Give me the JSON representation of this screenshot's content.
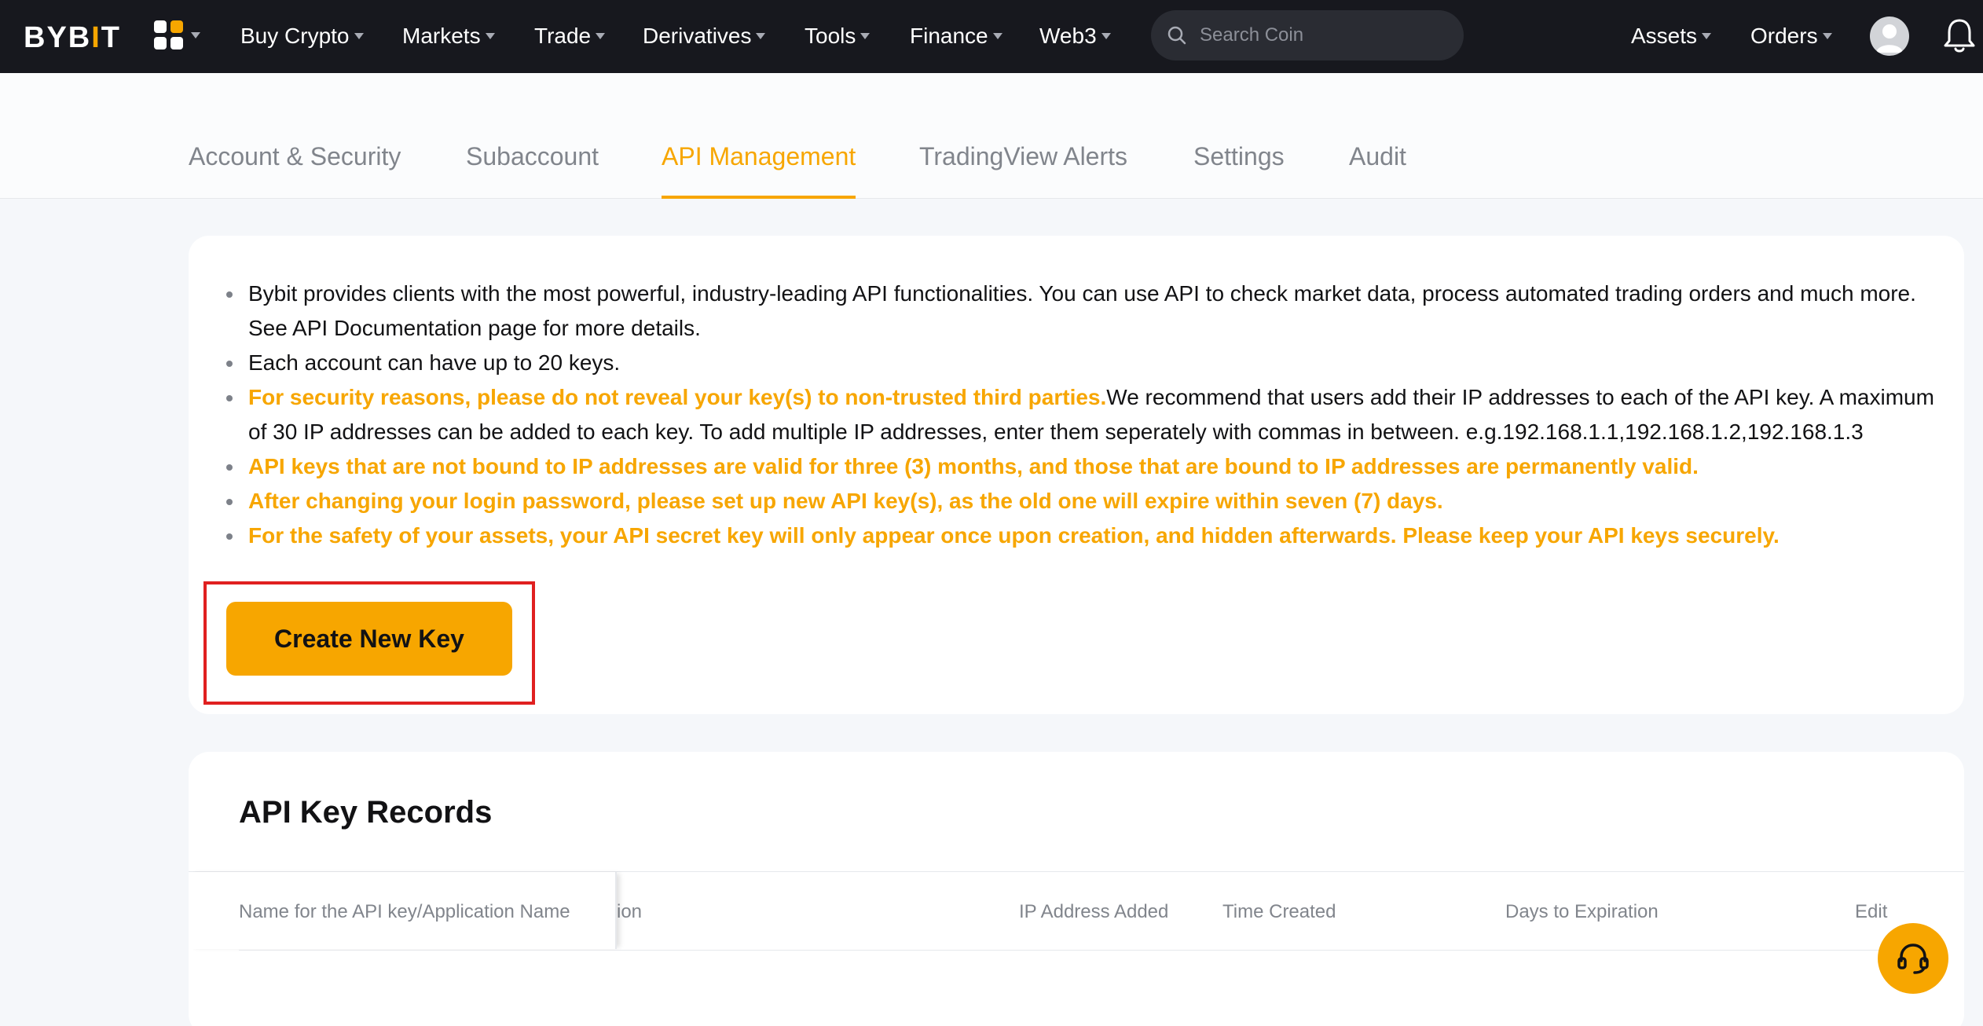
{
  "brand": {
    "logo_prefix": "BYB",
    "logo_bar": "I",
    "logo_suffix": "T",
    "accent_color": "#f7a600",
    "nav_bg": "#17181e"
  },
  "nav": {
    "apps_icon": "apps-grid-icon",
    "items": [
      "Buy Crypto",
      "Markets",
      "Trade",
      "Derivatives",
      "Tools",
      "Finance",
      "Web3"
    ],
    "search": {
      "placeholder": "Search Coin",
      "icon": "search-icon"
    },
    "right_items": [
      "Assets",
      "Orders"
    ],
    "avatar_icon": "user-avatar-icon",
    "bell_icon": "notification-bell-icon"
  },
  "subtabs": {
    "items": [
      "Account & Security",
      "Subaccount",
      "API Management",
      "TradingView Alerts",
      "Settings",
      "Audit"
    ],
    "active": "API Management"
  },
  "info": {
    "bullets": [
      {
        "text": "Bybit provides clients with the most powerful, industry-leading API functionalities. You can use API to check market data, process automated trading orders and much more. See API Documentation page for more details."
      },
      {
        "text": "Each account can have up to 20 keys."
      },
      {
        "warn": "For security reasons, please do not reveal your key(s) to non-trusted third parties.",
        "text": "We recommend that users add their IP addresses to each of the API key. A maximum of 30 IP addresses can be added to each key. To add multiple IP addresses, enter them seperately with commas in between. e.g.192.168.1.1,192.168.1.2,192.168.1.3"
      },
      {
        "warn": "API keys that are not bound to IP addresses are valid for three (3) months, and those that are bound to IP addresses are permanently valid."
      },
      {
        "warn": "After changing your login password, please set up new API key(s), as the old one will expire within seven (7) days."
      },
      {
        "warn": "For the safety of your assets, your API secret key will only appear once upon creation, and hidden afterwards. Please keep your API keys securely."
      }
    ],
    "create_button": "Create New Key"
  },
  "records": {
    "title": "API Key Records",
    "columns": [
      "Name for the API key/Application Name",
      "ion",
      "IP Address Added",
      "Time Created",
      "Days to Expiration",
      "Edit"
    ]
  },
  "support_icon": "customer-support-headset-icon"
}
